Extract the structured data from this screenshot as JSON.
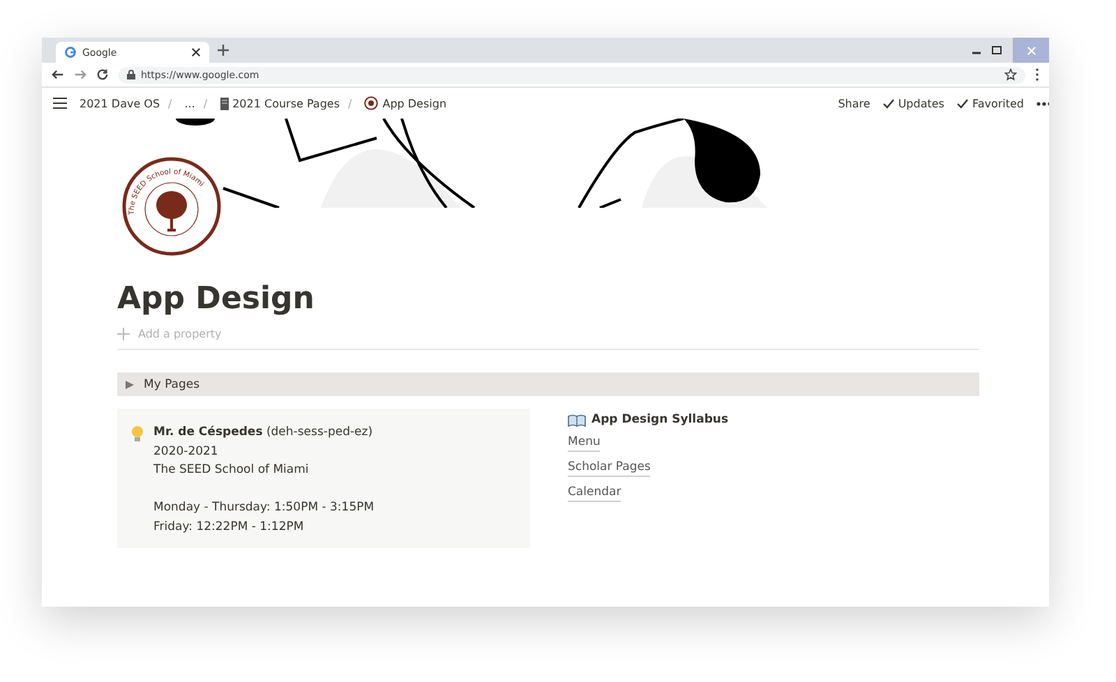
{
  "browser": {
    "tab_title": "Google",
    "url": "https://www.google.com"
  },
  "topbar": {
    "separator": "/",
    "breadcrumbs": [
      {
        "label": "2021 Dave OS",
        "kind": "plain"
      },
      {
        "label": "...",
        "kind": "plain"
      },
      {
        "label": "2021 Course Pages",
        "kind": "book"
      },
      {
        "label": "App Design",
        "kind": "school"
      }
    ],
    "actions": [
      {
        "label": "Share",
        "checked": false
      },
      {
        "label": "Updates",
        "checked": true
      },
      {
        "label": "Favorited",
        "checked": true
      }
    ]
  },
  "logo_text": "The SEED School of Miami",
  "title": "App Design",
  "add_property": "Add a property",
  "toggle": {
    "label": "My Pages",
    "expanded": false
  },
  "callout": {
    "name": "Mr. de Céspedes",
    "pronunciation": "(deh-sess-ped-ez)",
    "lines": [
      "2020-2021",
      "The SEED School of Miami"
    ],
    "hours": [
      "Monday - Thursday: 1:50PM - 3:15PM",
      "Friday: 12:22PM - 1:12PM"
    ]
  },
  "syllabus": {
    "title": "App Design Syllabus",
    "links": [
      "Menu",
      "Scholar Pages",
      "Calendar"
    ]
  }
}
